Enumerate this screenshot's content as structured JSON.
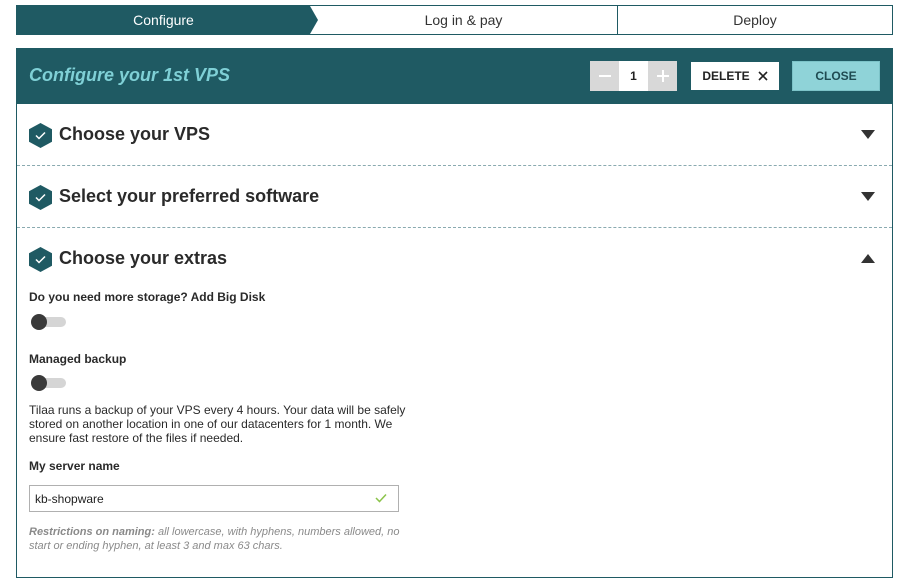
{
  "steps": [
    {
      "label": "Configure",
      "active": true
    },
    {
      "label": "Log in & pay",
      "active": false
    },
    {
      "label": "Deploy",
      "active": false
    }
  ],
  "header": {
    "title": "Configure your 1st VPS",
    "quantity": "1",
    "minus_icon": "minus-icon",
    "plus_icon": "plus-icon",
    "delete_label": "DELETE",
    "close_label": "CLOSE"
  },
  "sections": [
    {
      "title": "Choose your VPS",
      "expanded": false
    },
    {
      "title": "Select your preferred software",
      "expanded": false
    },
    {
      "title": "Choose your extras",
      "expanded": true
    }
  ],
  "extras": {
    "big_disk_label": "Do you need more storage? Add Big Disk",
    "big_disk_enabled": false,
    "backup_label": "Managed backup",
    "backup_enabled": false,
    "backup_info": "Tilaa runs a backup of your VPS every 4 hours. Your data will be safely stored on another location in one of our datacenters for 1 month. We ensure fast restore of the files if needed.",
    "server_name_label": "My server name",
    "server_name_value": "kb-shopware",
    "restrictions_title": "Restrictions on naming:",
    "restrictions_text": " all lowercase, with hyphens, numbers allowed, no start or ending hyphen, at least 3 and max 63 chars."
  },
  "colors": {
    "brand": "#1f5a63",
    "accent": "#8fd3d8",
    "valid": "#8bc34a"
  }
}
